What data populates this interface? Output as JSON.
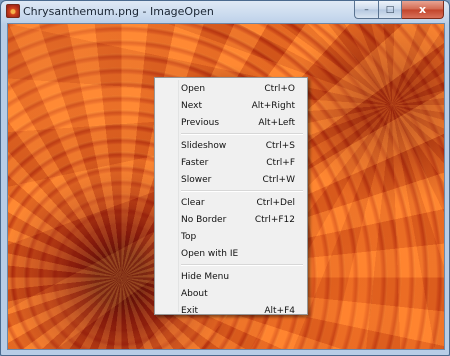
{
  "window": {
    "title": "Chrysanthemum.png - ImageOpen",
    "app_icon": "image-app-icon",
    "buttons": {
      "minimize": "–",
      "maximize": "□",
      "close": "x"
    }
  },
  "image": {
    "subject": "chrysanthemum-photo",
    "colors": {
      "petal": "#e85a1d",
      "center": "#4a0808",
      "highlight": "#ff8a32"
    }
  },
  "context_menu": {
    "items": [
      {
        "label": "Open",
        "shortcut": "Ctrl+O"
      },
      {
        "label": "Next",
        "shortcut": "Alt+Right"
      },
      {
        "label": "Previous",
        "shortcut": "Alt+Left"
      },
      {
        "separator": true
      },
      {
        "label": "Slideshow",
        "shortcut": "Ctrl+S"
      },
      {
        "label": "Faster",
        "shortcut": "Ctrl+F"
      },
      {
        "label": "Slower",
        "shortcut": "Ctrl+W"
      },
      {
        "separator": true
      },
      {
        "label": "Clear",
        "shortcut": "Ctrl+Del"
      },
      {
        "label": "No Border",
        "shortcut": "Ctrl+F12"
      },
      {
        "label": "Top",
        "shortcut": ""
      },
      {
        "label": "Open with IE",
        "shortcut": ""
      },
      {
        "separator": true
      },
      {
        "label": "Hide Menu",
        "shortcut": ""
      },
      {
        "label": "About",
        "shortcut": ""
      },
      {
        "label": "Exit",
        "shortcut": "Alt+F4"
      }
    ]
  }
}
